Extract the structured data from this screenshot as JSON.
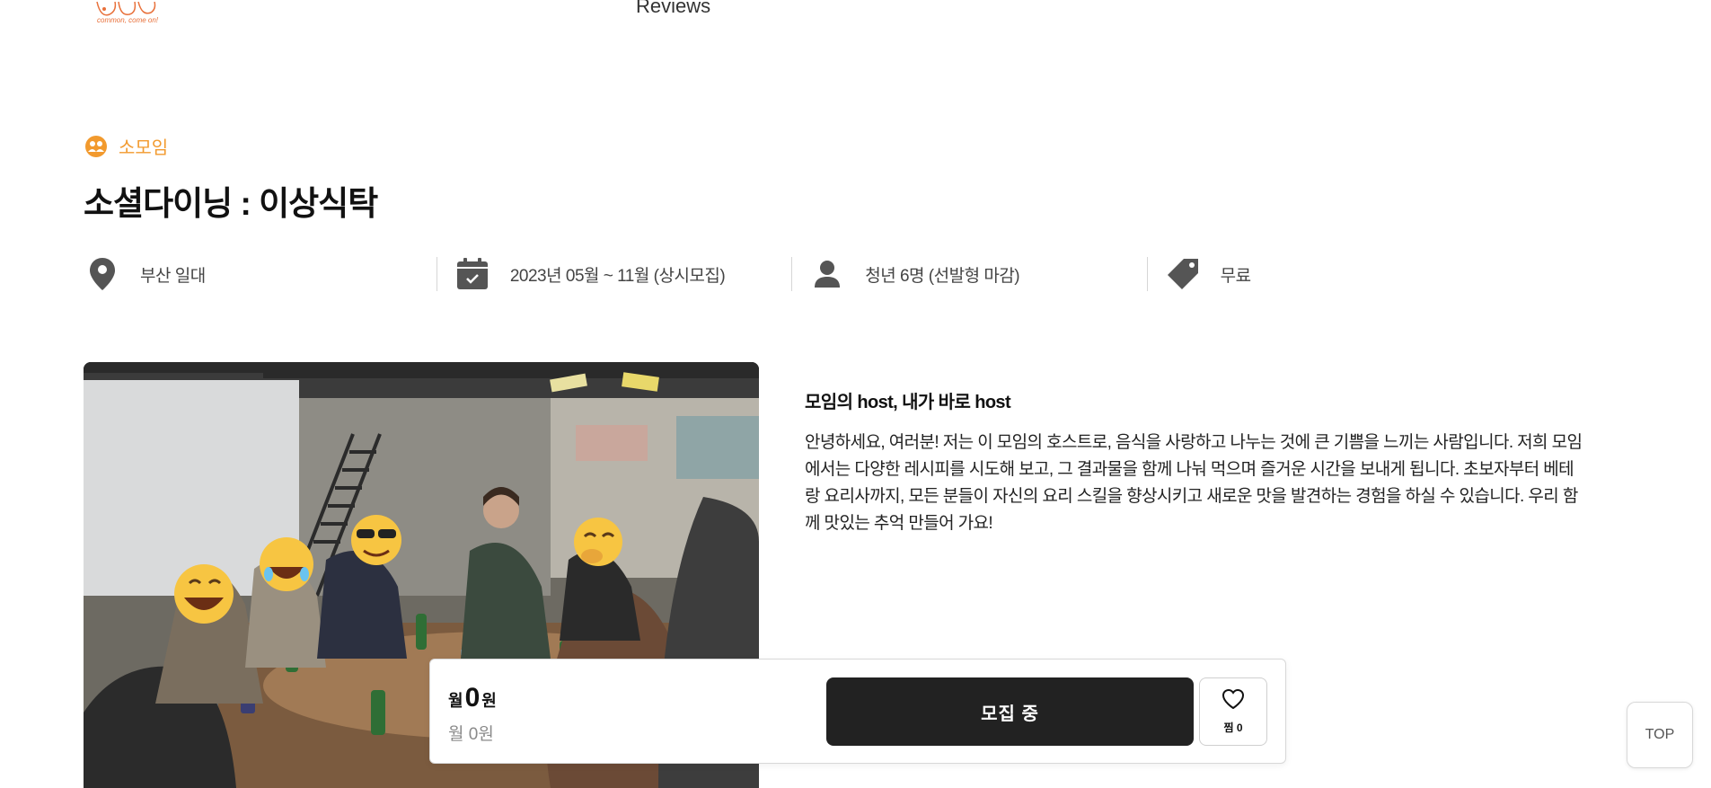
{
  "header": {
    "logo_text": "common, come on!",
    "nav_reviews": "Reviews"
  },
  "category": {
    "label": "소모임",
    "icon": "group-icon"
  },
  "title": "소셜다이닝 : 이상식탁",
  "info": {
    "location": "부산 일대",
    "period": "2023년 05월 ~ 11월 (상시모집)",
    "capacity": "청년 6명 (선발형 마감)",
    "fee": "무료"
  },
  "host": {
    "heading": "모임의 host, 내가 바로 host",
    "description": "안녕하세요, 여러분! 저는 이 모임의 호스트로, 음식을 사랑하고 나누는 것에 큰 기쁨을 느끼는 사람입니다. 저희 모임에서는 다양한 레시피를 시도해 보고, 그 결과물을 함께 나눠 먹으며 즐거운 시간을 보내게 됩니다. 초보자부터 베테랑 요리사까지, 모든 분들이 자신의 요리 스킬을 향상시키고 새로운 맛을 발견하는 경험을 하실 수 있습니다. 우리 함께 맛있는 추억 만들어 가요!"
  },
  "bottom_bar": {
    "price_prefix": "월",
    "price_value": "0",
    "price_unit": "원",
    "price_sub": "월 0원",
    "recruit_label": "모집 중",
    "like_label": "찜 0"
  },
  "top_button": "TOP",
  "colors": {
    "accent": "#f29a2e",
    "button_dark": "#222222",
    "logo": "#e8703a"
  }
}
